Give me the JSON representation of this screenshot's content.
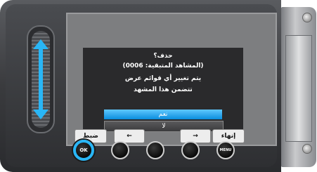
{
  "dialog": {
    "line1": "حذف؟",
    "line2": "(المشاهد المتبقية: 0006)",
    "line3": "يتم تغيير أي قوائم عرض",
    "line4": "تتضمن هذا المشهد",
    "option_yes": "نعم",
    "option_no": "لا"
  },
  "softkeys": {
    "left_label": "ضبط",
    "left_arrow": "←",
    "right_arrow": "→",
    "right_label": "إنهاء"
  },
  "hardware_buttons": {
    "ok_label": "OK",
    "menu_label": "MENU"
  },
  "colors": {
    "accent": "#29b6f6",
    "selected_option": "#0a8ddd"
  },
  "icons": {
    "slider": "vertical-double-arrow-icon",
    "screws": "screw-icon"
  }
}
